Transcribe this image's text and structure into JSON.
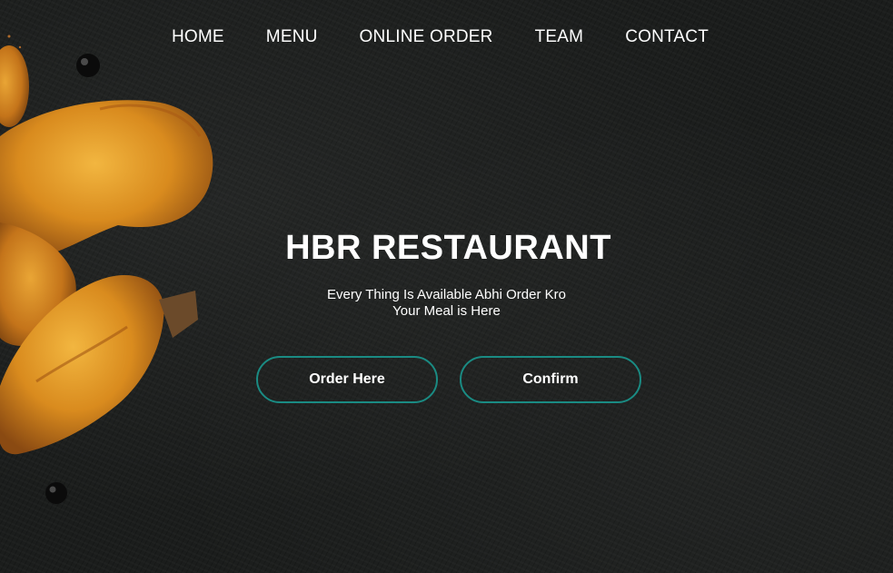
{
  "nav": {
    "items": [
      {
        "label": "HOME"
      },
      {
        "label": "MENU"
      },
      {
        "label": "ONLINE ORDER"
      },
      {
        "label": "TEAM"
      },
      {
        "label": "CONTACT"
      }
    ]
  },
  "hero": {
    "title": "HBR RESTAURANT",
    "subtitle_line1": "Every Thing Is Available Abhi Order Kro",
    "subtitle_line2": "Your Meal is Here",
    "buttons": {
      "order_label": "Order Here",
      "confirm_label": "Confirm"
    },
    "background_image": "roasted-chicken-drumsticks-on-dark-slate"
  },
  "colors": {
    "background": "#1b1d1c",
    "button_border": "#1a8b83",
    "text": "#ffffff"
  }
}
